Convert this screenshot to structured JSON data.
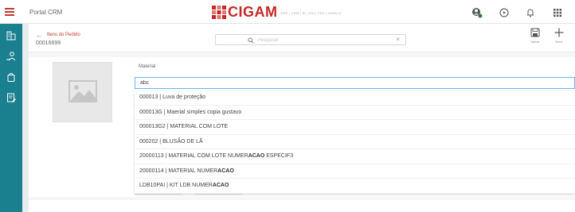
{
  "app": {
    "title": "Portal CRM"
  },
  "logo": {
    "brand": "CIGAM",
    "tagline": "ERP | CRM | BI | RH | PDV | MOBILE"
  },
  "subheader": {
    "back_label": "Itens do Pedido",
    "order_number": "00016699",
    "search_placeholder": "Pesquisar",
    "save_label": "Salvar",
    "new_label": "Novo"
  },
  "form": {
    "material_label": "Material",
    "material_value": "abc"
  },
  "suggestions": [
    {
      "prefix": "000013 | Luva de proteção",
      "match": "",
      "suffix": ""
    },
    {
      "prefix": "000013G | Maerial simples copia gustavo",
      "match": "",
      "suffix": ""
    },
    {
      "prefix": "000013G2 | MATERIAL COM LOTE",
      "match": "",
      "suffix": ""
    },
    {
      "prefix": "000202 | BLUSÃO DE LÃ",
      "match": "",
      "suffix": ""
    },
    {
      "prefix": "20000113 | MATERIAL COM LOTE NUMER",
      "match": "ACAO",
      "suffix": " ESPECIF3"
    },
    {
      "prefix": "20000114 | MATERIAL NUMER",
      "match": "ACAO",
      "suffix": ""
    },
    {
      "prefix": "LDB10PAI | KIT LDB NUMER",
      "match": "ACAO",
      "suffix": ""
    }
  ],
  "colors": {
    "sidebar": "#1a7f8e",
    "brand_red": "#c62828",
    "focus_border": "#64b5f6"
  }
}
